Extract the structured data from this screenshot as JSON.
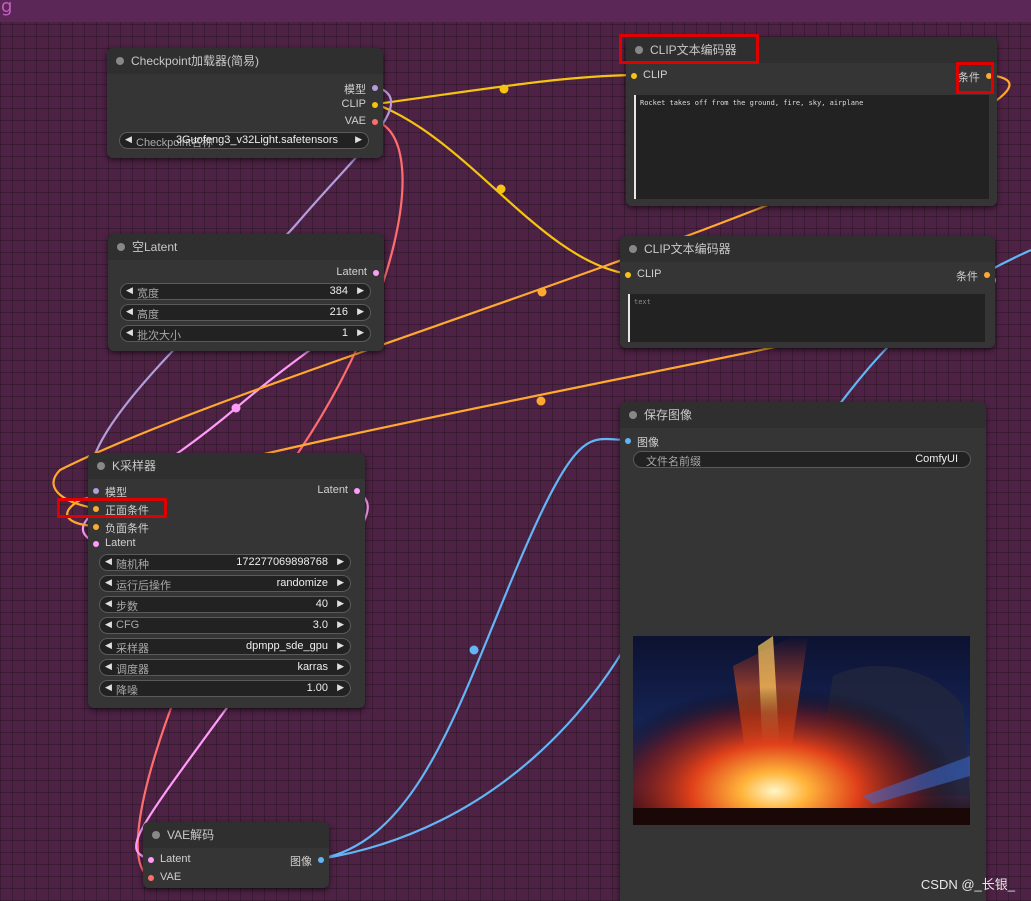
{
  "app": {
    "logo_letter": "g"
  },
  "colors": {
    "clip": "#f5c412",
    "model": "#b39ddb",
    "vae": "#ff6e6e",
    "latent": "#ff9cf9",
    "conditioning": "#ffa931",
    "image": "#64b5f6"
  },
  "checkpoint_loader": {
    "title": "Checkpoint加载器(简易)",
    "outputs": {
      "model": "模型",
      "clip": "CLIP",
      "vae": "VAE"
    },
    "ckpt_label": "Checkpoint名称",
    "ckpt_value": "3Guofeng3_v32Light.safetensors"
  },
  "clip_encoder_positive": {
    "title": "CLIP文本编码器",
    "input_clip": "CLIP",
    "output_conditioning": "条件",
    "text": "Rocket takes off from the ground, fire, sky, airplane"
  },
  "clip_encoder_negative": {
    "title": "CLIP文本编码器",
    "input_clip": "CLIP",
    "output_conditioning": "条件",
    "placeholder": "text"
  },
  "empty_latent": {
    "title": "空Latent",
    "output_latent": "Latent",
    "widgets": [
      {
        "label": "宽度",
        "value": "384"
      },
      {
        "label": "高度",
        "value": "216"
      },
      {
        "label": "批次大小",
        "value": "1"
      }
    ]
  },
  "ksampler": {
    "title": "K采样器",
    "inputs": {
      "model": "模型",
      "positive": "正面条件",
      "negative": "负面条件",
      "latent": "Latent"
    },
    "output_latent": "Latent",
    "widgets": [
      {
        "label": "随机种",
        "value": "172277069898768"
      },
      {
        "label": "运行后操作",
        "value": "randomize"
      },
      {
        "label": "步数",
        "value": "40"
      },
      {
        "label": "CFG",
        "value": "3.0"
      },
      {
        "label": "采样器",
        "value": "dpmpp_sde_gpu"
      },
      {
        "label": "调度器",
        "value": "karras"
      },
      {
        "label": "降噪",
        "value": "1.00"
      }
    ]
  },
  "save_image": {
    "title": "保存图像",
    "input_image": "图像",
    "prefix_label": "文件名前缀",
    "prefix_value": "ComfyUI"
  },
  "vae_decode": {
    "title": "VAE解码",
    "inputs": {
      "latent": "Latent",
      "vae": "VAE"
    },
    "output_image": "图像"
  },
  "watermark": "CSDN @_长银_"
}
